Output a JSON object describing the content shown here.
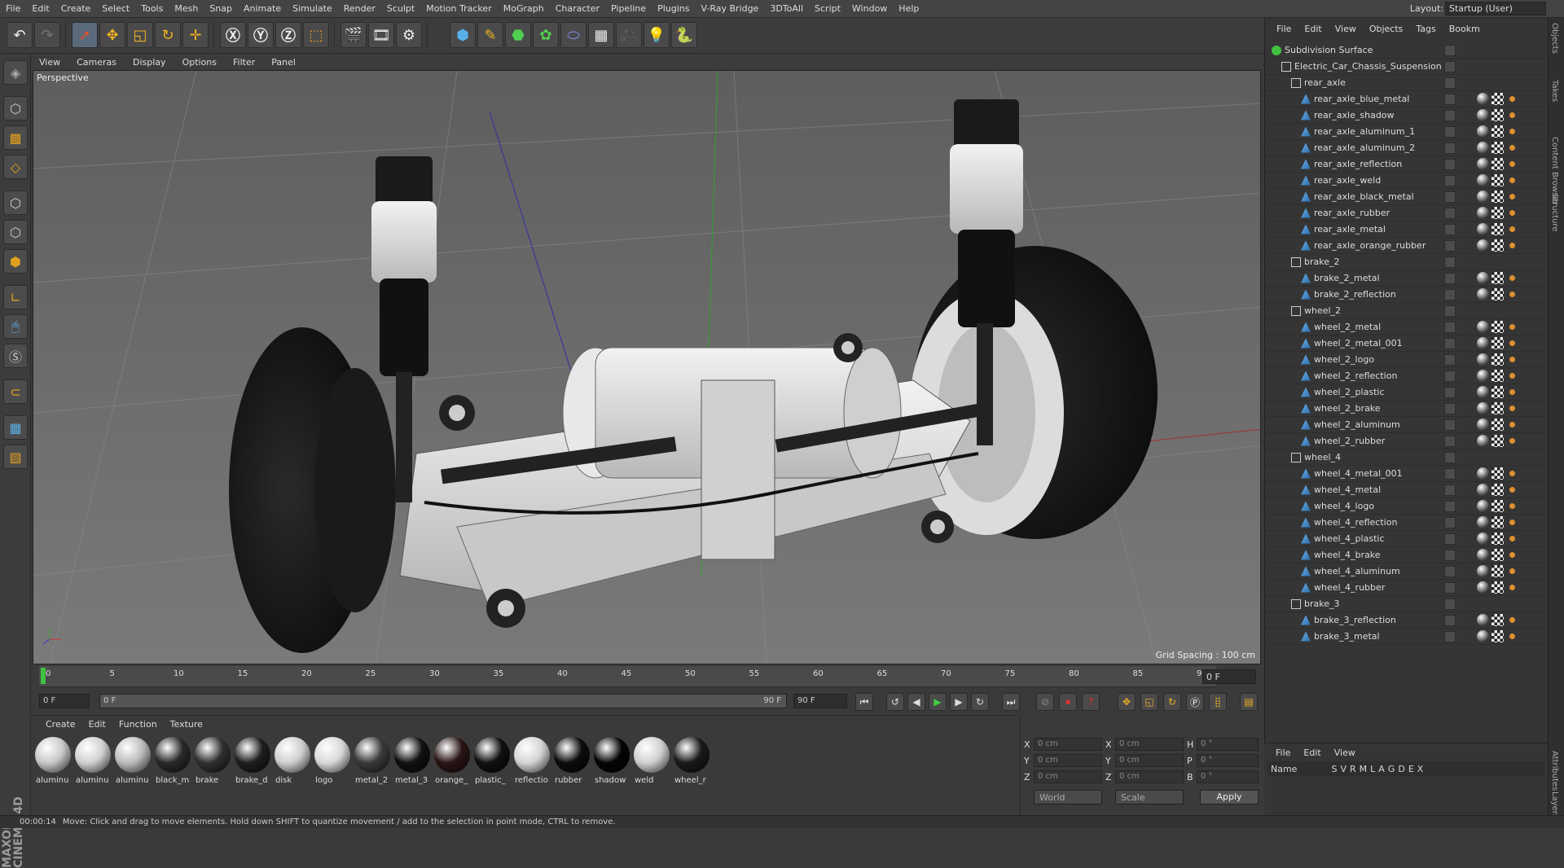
{
  "menubar": {
    "items": [
      "File",
      "Edit",
      "Create",
      "Select",
      "Tools",
      "Mesh",
      "Snap",
      "Animate",
      "Simulate",
      "Render",
      "Sculpt",
      "Motion Tracker",
      "MoGraph",
      "Character",
      "Pipeline",
      "Plugins",
      "V-Ray Bridge",
      "3DToAll",
      "Script",
      "Window",
      "Help"
    ],
    "layout_label": "Layout:",
    "layout_value": "Startup (User)"
  },
  "viewport": {
    "menu": [
      "View",
      "Cameras",
      "Display",
      "Options",
      "Filter",
      "Panel"
    ],
    "name": "Perspective",
    "grid_spacing": "Grid Spacing : 100 cm"
  },
  "timeline": {
    "ticks": [
      "0",
      "5",
      "10",
      "15",
      "20",
      "25",
      "30",
      "35",
      "40",
      "45",
      "50",
      "55",
      "60",
      "65",
      "70",
      "75",
      "80",
      "85",
      "90"
    ],
    "current_frame": "0 F",
    "start_frame": "0 F",
    "range_start": "0 F",
    "range_end": "90 F",
    "end_frame": "90 F"
  },
  "materials": {
    "menu": [
      "Create",
      "Edit",
      "Function",
      "Texture"
    ],
    "items": [
      {
        "label": "aluminu",
        "color": "#c8c8c8"
      },
      {
        "label": "aluminu",
        "color": "#d0d0d0"
      },
      {
        "label": "aluminu",
        "color": "#bcbcbc"
      },
      {
        "label": "black_m",
        "color": "#2a2a2a"
      },
      {
        "label": "brake",
        "color": "#303030"
      },
      {
        "label": "brake_d",
        "color": "#1e1e1e"
      },
      {
        "label": "disk",
        "color": "#cfcfcf"
      },
      {
        "label": "logo",
        "color": "#d8d8d8"
      },
      {
        "label": "metal_2",
        "color": "#3a3a3a"
      },
      {
        "label": "metal_3",
        "color": "#111111"
      },
      {
        "label": "orange_",
        "color": "#2a1515"
      },
      {
        "label": "plastic_",
        "color": "#101010"
      },
      {
        "label": "reflectio",
        "color": "#d4d4d4"
      },
      {
        "label": "rubber",
        "color": "#0c0c0c"
      },
      {
        "label": "shadow",
        "color": "#050505"
      },
      {
        "label": "weld",
        "color": "#d0d0d0"
      },
      {
        "label": "wheel_r",
        "color": "#1a1a1a"
      }
    ]
  },
  "coords": {
    "x_pos": "0 cm",
    "y_pos": "0 cm",
    "z_pos": "0 cm",
    "x_size": "0 cm",
    "y_size": "0 cm",
    "z_size": "0 cm",
    "h": "0 °",
    "p": "0 °",
    "b": "0 °",
    "labels": {
      "x": "X",
      "y": "Y",
      "z": "Z",
      "h": "H",
      "p": "P",
      "b": "B"
    },
    "mode": "World",
    "type": "Scale",
    "apply": "Apply"
  },
  "status": {
    "time": "00:00:14",
    "message": "Move: Click and drag to move elements. Hold down SHIFT to quantize movement / add to the selection in point mode, CTRL to remove."
  },
  "objects": {
    "menu": [
      "File",
      "Edit",
      "View",
      "Objects",
      "Tags",
      "Bookm"
    ],
    "rows": [
      {
        "name": "Subdivision Surface",
        "level": 0,
        "type": "sds"
      },
      {
        "name": "Electric_Car_Chassis_Suspension",
        "level": 1,
        "type": "null"
      },
      {
        "name": "rear_axle",
        "level": 2,
        "type": "null"
      },
      {
        "name": "rear_axle_blue_metal",
        "level": 3,
        "type": "poly"
      },
      {
        "name": "rear_axle_shadow",
        "level": 3,
        "type": "poly"
      },
      {
        "name": "rear_axle_aluminum_1",
        "level": 3,
        "type": "poly"
      },
      {
        "name": "rear_axle_aluminum_2",
        "level": 3,
        "type": "poly"
      },
      {
        "name": "rear_axle_reflection",
        "level": 3,
        "type": "poly"
      },
      {
        "name": "rear_axle_weld",
        "level": 3,
        "type": "poly"
      },
      {
        "name": "rear_axle_black_metal",
        "level": 3,
        "type": "poly"
      },
      {
        "name": "rear_axle_rubber",
        "level": 3,
        "type": "poly"
      },
      {
        "name": "rear_axle_metal",
        "level": 3,
        "type": "poly"
      },
      {
        "name": "rear_axle_orange_rubber",
        "level": 3,
        "type": "poly"
      },
      {
        "name": "brake_2",
        "level": 2,
        "type": "null"
      },
      {
        "name": "brake_2_metal",
        "level": 3,
        "type": "poly"
      },
      {
        "name": "brake_2_reflection",
        "level": 3,
        "type": "poly"
      },
      {
        "name": "wheel_2",
        "level": 2,
        "type": "null"
      },
      {
        "name": "wheel_2_metal",
        "level": 3,
        "type": "poly"
      },
      {
        "name": "wheel_2_metal_001",
        "level": 3,
        "type": "poly"
      },
      {
        "name": "wheel_2_logo",
        "level": 3,
        "type": "poly"
      },
      {
        "name": "wheel_2_reflection",
        "level": 3,
        "type": "poly"
      },
      {
        "name": "wheel_2_plastic",
        "level": 3,
        "type": "poly"
      },
      {
        "name": "wheel_2_brake",
        "level": 3,
        "type": "poly"
      },
      {
        "name": "wheel_2_aluminum",
        "level": 3,
        "type": "poly"
      },
      {
        "name": "wheel_2_rubber",
        "level": 3,
        "type": "poly"
      },
      {
        "name": "wheel_4",
        "level": 2,
        "type": "null"
      },
      {
        "name": "wheel_4_metal_001",
        "level": 3,
        "type": "poly"
      },
      {
        "name": "wheel_4_metal",
        "level": 3,
        "type": "poly"
      },
      {
        "name": "wheel_4_logo",
        "level": 3,
        "type": "poly"
      },
      {
        "name": "wheel_4_reflection",
        "level": 3,
        "type": "poly"
      },
      {
        "name": "wheel_4_plastic",
        "level": 3,
        "type": "poly"
      },
      {
        "name": "wheel_4_brake",
        "level": 3,
        "type": "poly"
      },
      {
        "name": "wheel_4_aluminum",
        "level": 3,
        "type": "poly"
      },
      {
        "name": "wheel_4_rubber",
        "level": 3,
        "type": "poly"
      },
      {
        "name": "brake_3",
        "level": 2,
        "type": "null"
      },
      {
        "name": "brake_3_reflection",
        "level": 3,
        "type": "poly"
      },
      {
        "name": "brake_3_metal",
        "level": 3,
        "type": "poly"
      }
    ]
  },
  "side_tabs": [
    "Objects",
    "Takes",
    "Content Browser",
    "Structure"
  ],
  "side_tabs_bottom": [
    "Attributes",
    "Layers"
  ],
  "attributes": {
    "menu": [
      "File",
      "Edit",
      "View"
    ],
    "columns": [
      "Name",
      "S",
      "V",
      "R",
      "M",
      "L",
      "A",
      "G",
      "D",
      "E",
      "X"
    ]
  }
}
